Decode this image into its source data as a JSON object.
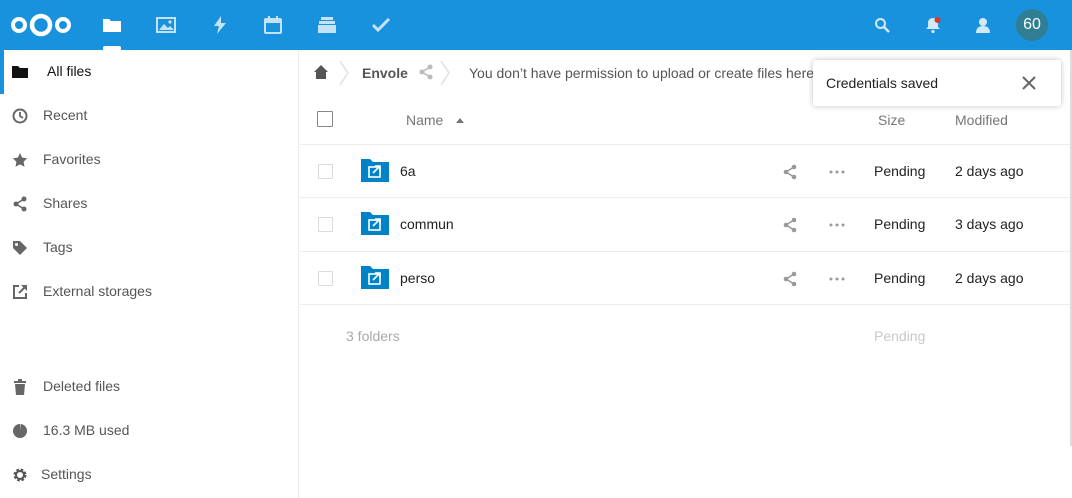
{
  "header": {
    "logo": "nextcloud-logo",
    "apps": [
      {
        "name": "files",
        "icon": "folder-icon",
        "active": true
      },
      {
        "name": "photos",
        "icon": "image-icon"
      },
      {
        "name": "activity",
        "icon": "lightning-icon"
      },
      {
        "name": "calendar",
        "icon": "calendar-icon"
      },
      {
        "name": "deck",
        "icon": "deck-icon"
      },
      {
        "name": "tasks",
        "icon": "checkmark-icon"
      }
    ],
    "avatar_text": "60",
    "colors": {
      "brand": "#1992de",
      "avatar": "#2f7e93",
      "notification_dot": "#e9322d"
    }
  },
  "sidebar": {
    "items": [
      {
        "label": "All files",
        "icon": "folder-icon",
        "active": true
      },
      {
        "label": "Recent",
        "icon": "clock-icon"
      },
      {
        "label": "Favorites",
        "icon": "star-icon"
      },
      {
        "label": "Shares",
        "icon": "share-icon"
      },
      {
        "label": "Tags",
        "icon": "tag-icon"
      },
      {
        "label": "External storages",
        "icon": "external-link-icon"
      }
    ],
    "bottom": [
      {
        "label": "Deleted files",
        "icon": "trash-icon"
      },
      {
        "label": "16.3 MB used",
        "icon": "pie-chart-icon"
      },
      {
        "label": "Settings",
        "icon": "gear-icon"
      }
    ]
  },
  "breadcrumb": {
    "folder": "Envole",
    "notice": "You don’t have permission to upload or create files here"
  },
  "table": {
    "columns": {
      "name": "Name",
      "size": "Size",
      "modified": "Modified"
    },
    "rows": [
      {
        "name": "6a",
        "size": "Pending",
        "modified": "2 days ago"
      },
      {
        "name": "commun",
        "size": "Pending",
        "modified": "3 days ago"
      },
      {
        "name": "perso",
        "size": "Pending",
        "modified": "2 days ago"
      }
    ],
    "summary": {
      "count": "3 folders",
      "size": "Pending"
    }
  },
  "toast": {
    "message": "Credentials saved"
  }
}
